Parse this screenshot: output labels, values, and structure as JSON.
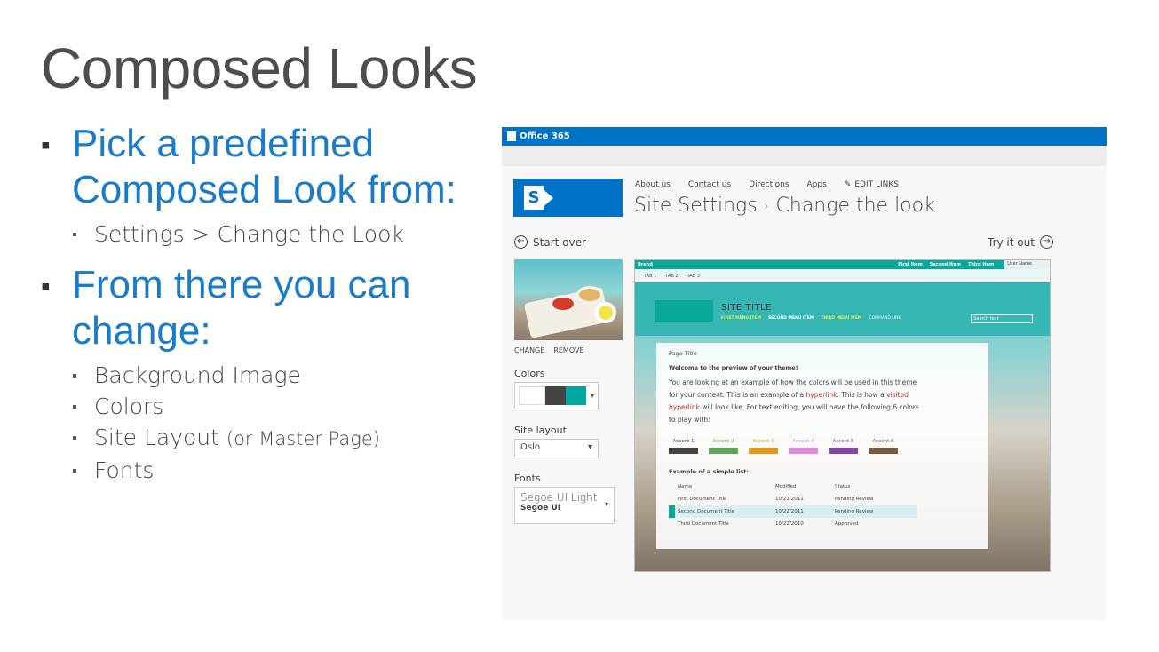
{
  "slide": {
    "title": "Composed Looks",
    "bullets": [
      {
        "text": "Pick a predefined Composed Look from:",
        "sub": [
          "Settings > Change the Look"
        ]
      },
      {
        "text": "From there you can change:",
        "sub": [
          "Background Image",
          "Colors",
          "Site Layout",
          "Fonts"
        ],
        "sub_note": "(or Master Page)"
      }
    ]
  },
  "screenshot": {
    "suite_bar": {
      "brand": "Office 365"
    },
    "top_nav": [
      "About us",
      "Contact us",
      "Directions",
      "Apps"
    ],
    "edit_links": "EDIT LINKS",
    "breadcrumb": {
      "parent": "Site Settings",
      "separator": "›",
      "current": "Change the look"
    },
    "start_over": "Start over",
    "try_it_out": "Try it out",
    "image_actions": {
      "change": "CHANGE",
      "remove": "REMOVE"
    },
    "colors_label": "Colors",
    "palette": [
      "#ffffff",
      "#444444",
      "#00a8a0"
    ],
    "site_layout_label": "Site layout",
    "site_layout_value": "Oslo",
    "fonts_label": "Fonts",
    "fonts_value": {
      "heading": "Segoe UI Light",
      "body": "Segoe UI"
    },
    "preview": {
      "brand": "Brand",
      "top_links": [
        "First Item",
        "Second Item",
        "Third Item"
      ],
      "user_name": "User Name",
      "tabs": [
        "TAB 1",
        "TAB 2",
        "TAB 3"
      ],
      "site_title": "SITE TITLE",
      "menu": {
        "first": "FIRST MENU ITEM",
        "second": "SECOND MENU ITEM",
        "third": "THIRD MENU ITEM",
        "command": "COMMAND LINK"
      },
      "search_placeholder": "Search text",
      "page_title": "Page Title",
      "welcome": "Welcome to the preview of your theme!",
      "body_1": "You are looking at an example of how the colors will be used in this theme for your content. This is an example of a",
      "hyperlink": "hyperlink",
      "body_2": ". This is how a",
      "visited": "visited hyperlink",
      "body_3": "will look like. For text editing, you will have the following 6 colors to play with:",
      "accents": [
        {
          "label": "Accent 1",
          "color": "#444444"
        },
        {
          "label": "Accent 2",
          "color": "#5fa65b"
        },
        {
          "label": "Accent 3",
          "color": "#e09a1b"
        },
        {
          "label": "Accent 4",
          "color": "#dc8bd8"
        },
        {
          "label": "Accent 5",
          "color": "#8a45a2"
        },
        {
          "label": "Accent 6",
          "color": "#7a5b3d"
        }
      ],
      "list_heading": "Example of a simple list:",
      "list_columns": [
        "Name",
        "Modified",
        "Status"
      ],
      "list_rows": [
        [
          "First Document Title",
          "10/21/2011",
          "Pending Review"
        ],
        [
          "Second Document Title",
          "10/22/2011",
          "Pending Review"
        ],
        [
          "Third Document Title",
          "10/22/2010",
          "Approved"
        ]
      ]
    }
  }
}
